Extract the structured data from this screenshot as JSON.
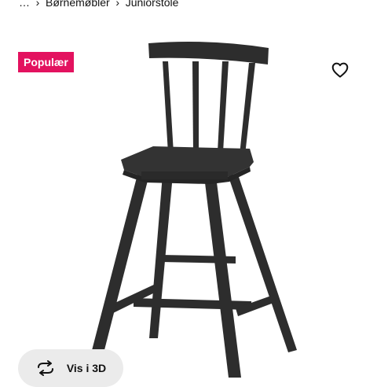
{
  "breadcrumb": {
    "items": [
      {
        "label": "…"
      },
      {
        "label": "Børnemøbler"
      },
      {
        "label": "Juniorstole"
      }
    ],
    "separator": "›"
  },
  "badge": {
    "label": "Populær",
    "color": "#e3125f"
  },
  "favorite": {
    "icon": "heart-outline-icon"
  },
  "product_image": {
    "subject": "black wooden junior chair"
  },
  "view_3d": {
    "label": "Vis i 3D",
    "icon": "rotate-3d-icon"
  },
  "colors": {
    "chair": "#2d2d2d",
    "pill": "#ebebeb"
  }
}
